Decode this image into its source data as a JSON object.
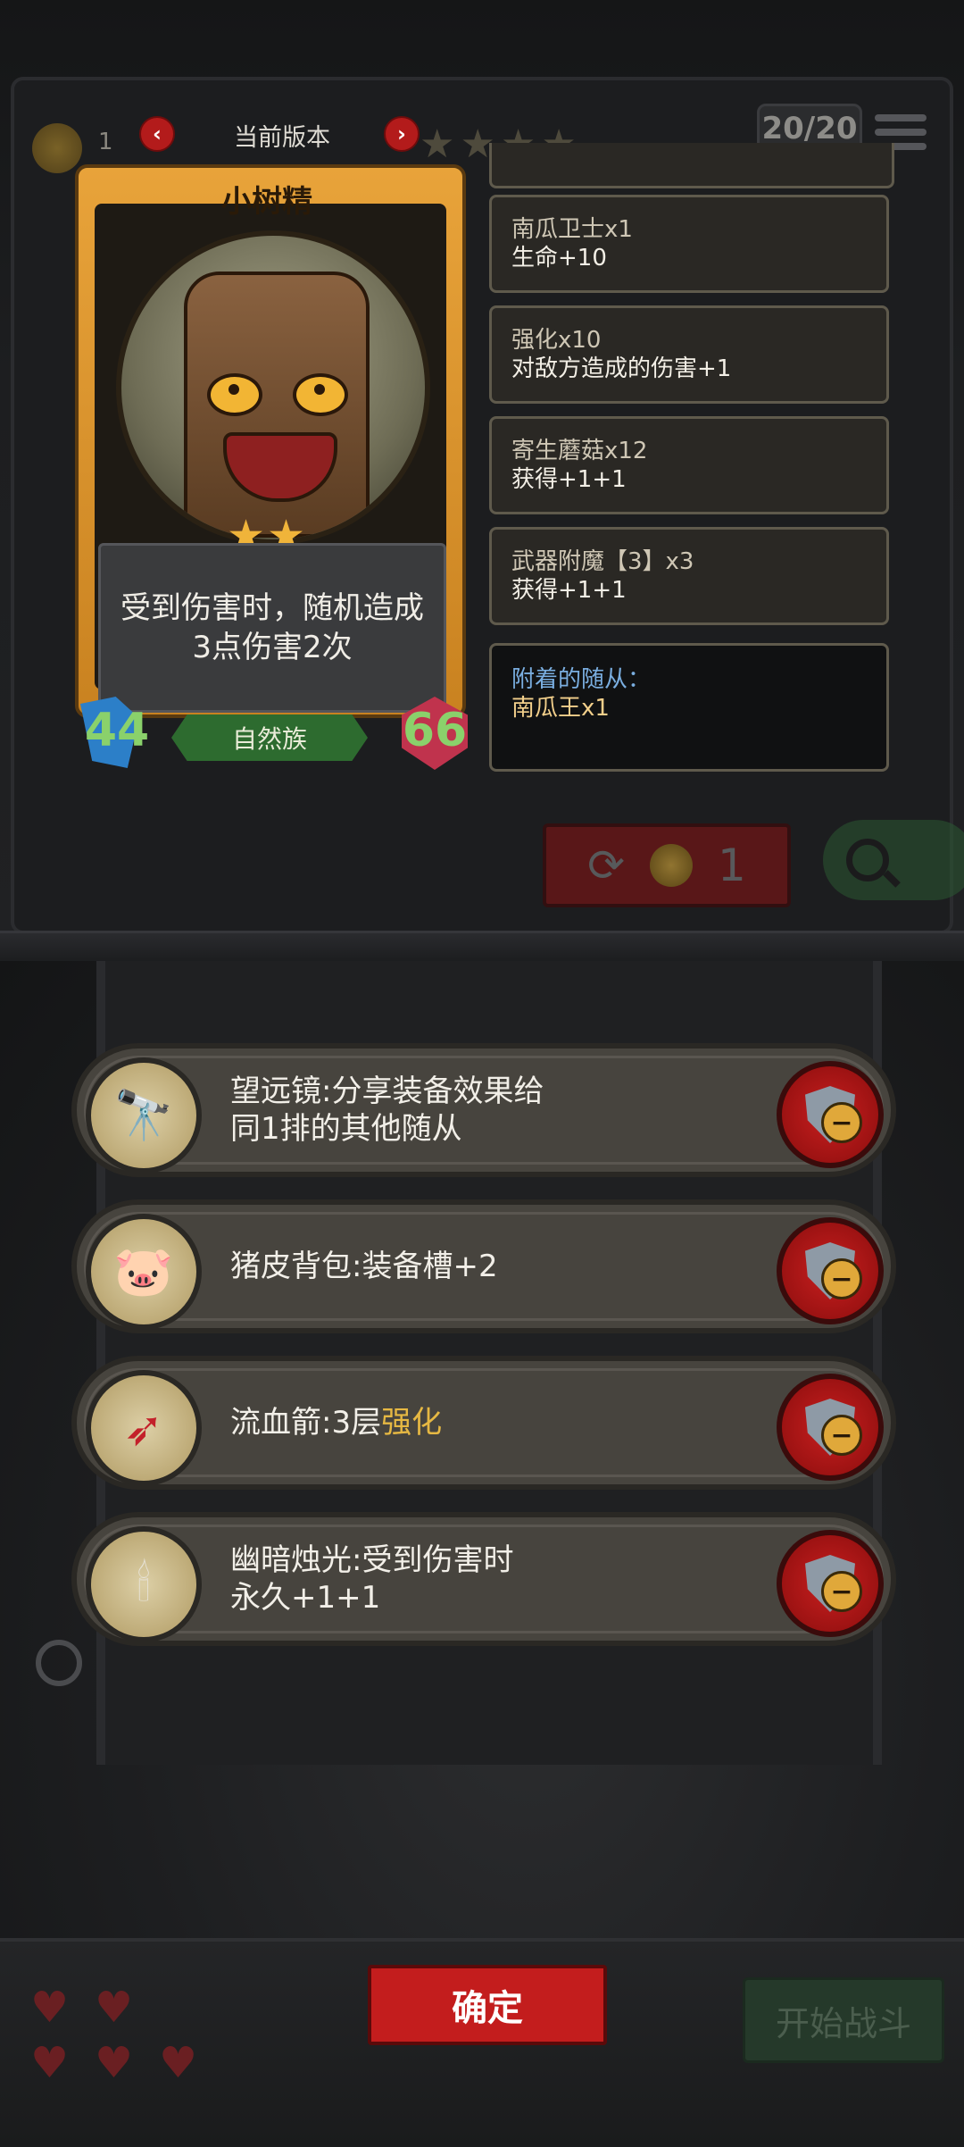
{
  "hud": {
    "coins": "1",
    "counter": "20/20",
    "version_title": "当前版本"
  },
  "card": {
    "name": "小树精",
    "stars": "★★",
    "description": "受到伤害时，随机造成3点伤害2次",
    "attack": "44",
    "health": "66",
    "tribe": "自然族"
  },
  "effects": {
    "items": [
      {
        "title": "南瓜卫士x1",
        "desc": "生命+10"
      },
      {
        "title": "强化x10",
        "desc": "对敌方造成的伤害+1"
      },
      {
        "title": "寄生蘑菇x12",
        "desc": "获得+1+1"
      },
      {
        "title": "武器附魔【3】x3",
        "desc": "获得+1+1"
      }
    ],
    "attached_label": "附着的随从：",
    "attached_value": "南瓜王x1"
  },
  "reroll": {
    "cost": "1"
  },
  "equipment": [
    {
      "icon": "telescope-icon",
      "line1": "望远镜:分享装备效果给",
      "line2": "同1排的其他随从"
    },
    {
      "icon": "pig-backpack-icon",
      "line1": "猪皮背包:装备槽+2",
      "line2": ""
    },
    {
      "icon": "bleeding-arrow-icon",
      "line1": "流血箭:3层",
      "highlight": "强化",
      "line2": ""
    },
    {
      "icon": "candelabra-icon",
      "line1": "幽暗烛光:受到伤害时",
      "line2": "永久+1+1"
    }
  ],
  "buttons": {
    "confirm": "确定",
    "start_battle": "开始战斗"
  },
  "colors": {
    "accent_red": "#c31d1d",
    "tribe_green": "#2d6b2f",
    "attack_blue": "#2c7fc8",
    "health_pink": "#c0334d",
    "stat_text": "#8ad16b"
  }
}
